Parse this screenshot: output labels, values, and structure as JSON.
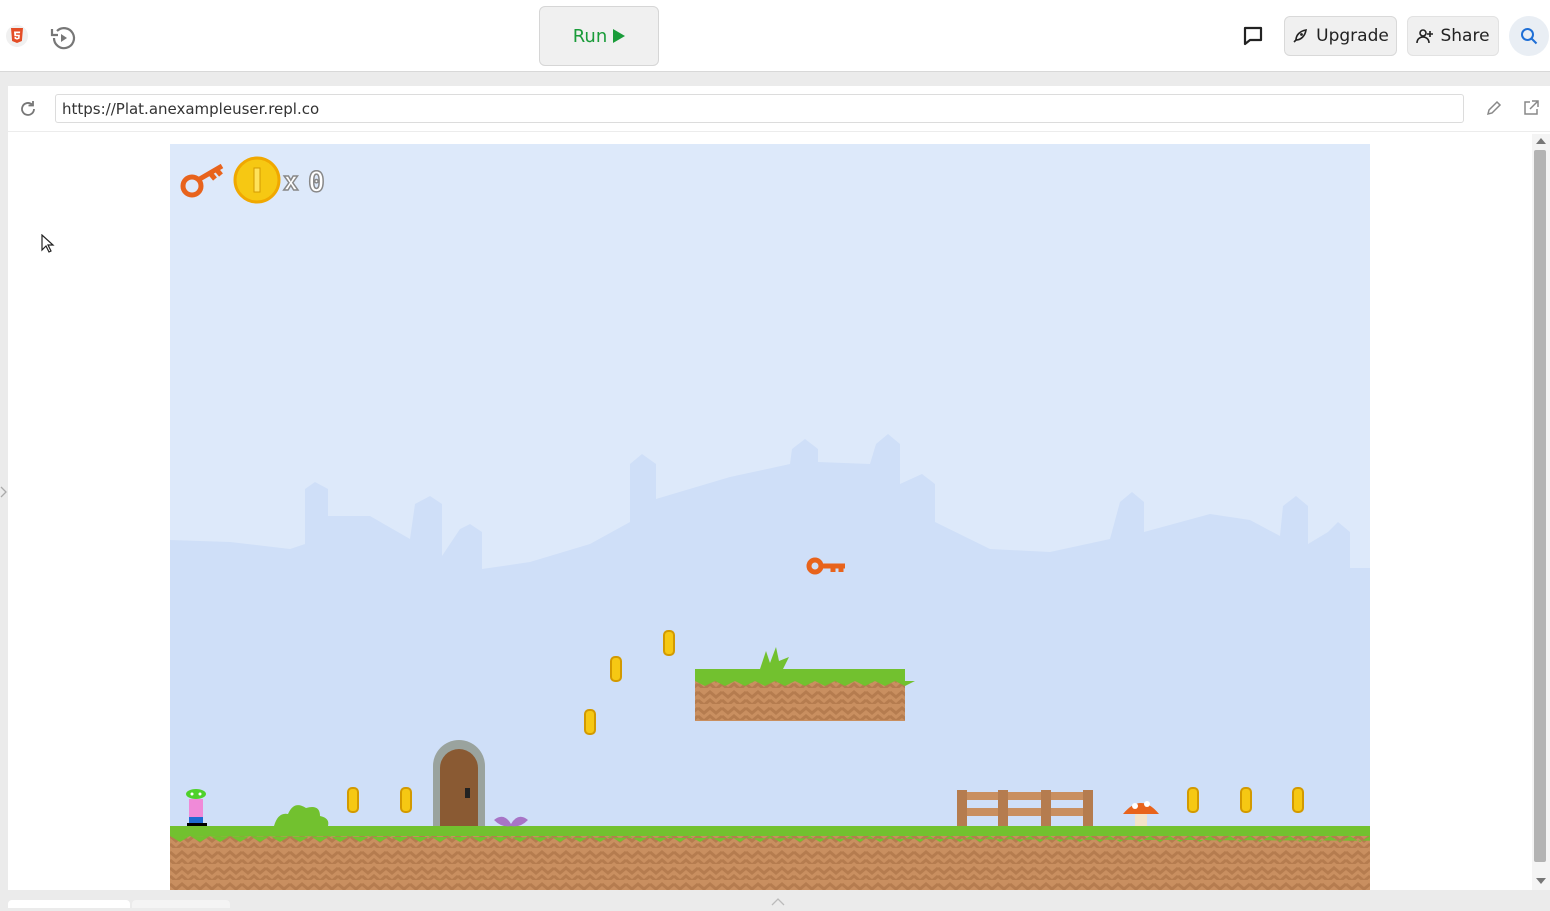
{
  "toolbar": {
    "run_label": "Run",
    "upgrade_label": "Upgrade",
    "share_label": "Share"
  },
  "webview": {
    "url": "https://Plat.anexampleuser.repl.co"
  },
  "game": {
    "hud": {
      "times_glyph": "x",
      "coin_count": "0"
    }
  },
  "icons": {
    "html5": "html5-icon",
    "history": "history-icon",
    "chat": "chat-icon",
    "upgrade": "rocket-icon",
    "share": "add-user-icon",
    "search": "search-icon",
    "reload": "reload-icon",
    "edit": "pencil-icon",
    "popout": "external-link-icon"
  },
  "colors": {
    "run_green": "#1a9c3a",
    "sky": "#dde9fa",
    "grass": "#72c12f",
    "dirt": "#c98f60",
    "coin": "#f6c813",
    "key": "#e8631c"
  }
}
